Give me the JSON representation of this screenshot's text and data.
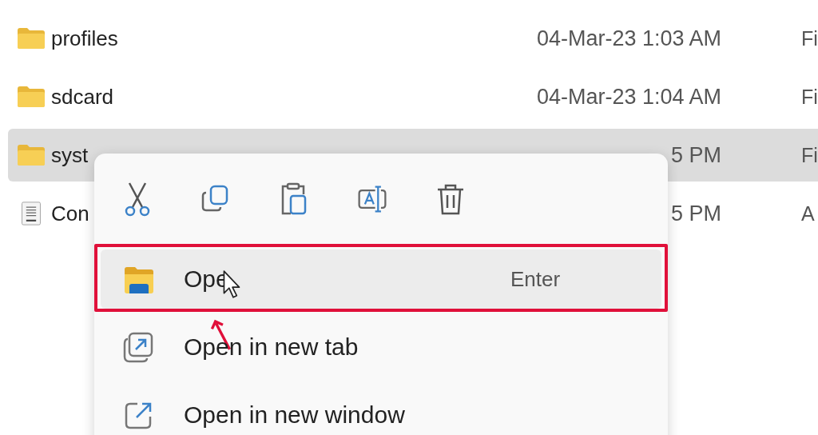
{
  "file_list": {
    "rows": [
      {
        "kind": "folder",
        "name": "profiles",
        "date": "04-Mar-23 1:03 AM",
        "type": "Fi",
        "selected": false
      },
      {
        "kind": "folder",
        "name": "sdcard",
        "date": "04-Mar-23 1:04 AM",
        "type": "Fi",
        "selected": false
      },
      {
        "kind": "folder",
        "name": "syst",
        "date": "5 PM",
        "type": "Fi",
        "selected": true
      },
      {
        "kind": "file",
        "name": "Con",
        "date": "5 PM",
        "type": "A",
        "selected": false
      }
    ]
  },
  "context_menu": {
    "toolbar": [
      {
        "kind": "cut"
      },
      {
        "kind": "copy"
      },
      {
        "kind": "paste"
      },
      {
        "kind": "rename"
      },
      {
        "kind": "delete"
      }
    ],
    "items": [
      {
        "kind": "open",
        "label": "Ope",
        "shortcut": "Enter",
        "hovered": true,
        "highlighted": true
      },
      {
        "kind": "new_tab",
        "label": "Open in new tab",
        "hovered": false,
        "highlighted": false
      },
      {
        "kind": "new_window",
        "label": "Open in new window",
        "hovered": false,
        "highlighted": false
      }
    ]
  }
}
